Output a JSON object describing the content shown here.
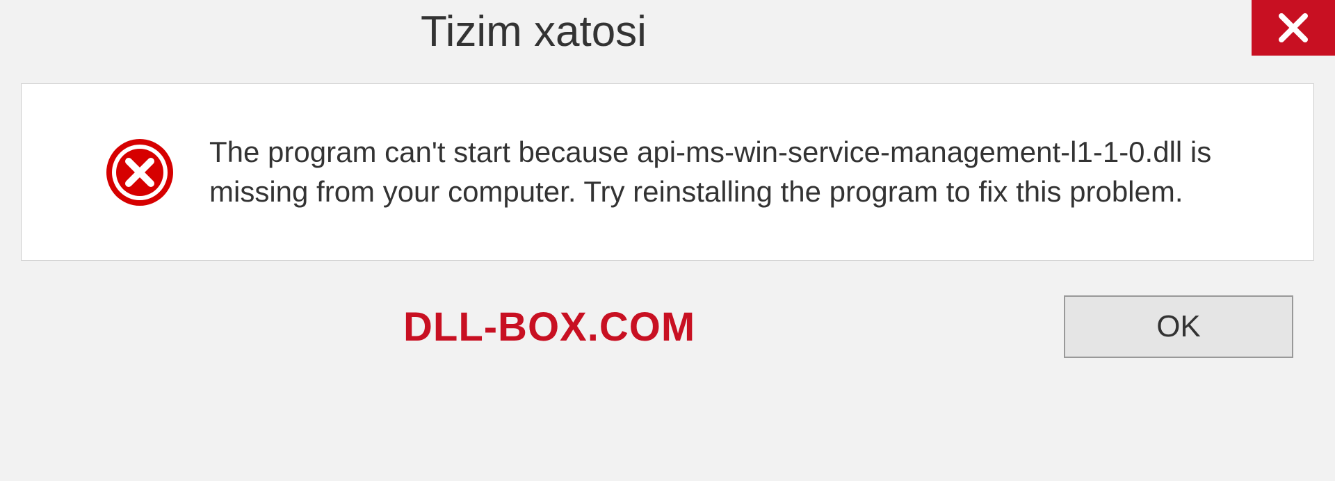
{
  "dialog": {
    "title": "Tizim xatosi",
    "message": "The program can't start because api-ms-win-service-management-l1-1-0.dll is missing from your computer. Try reinstalling the program to fix this problem.",
    "ok_label": "OK"
  },
  "watermark": "DLL-BOX.COM",
  "colors": {
    "accent_red": "#c81022"
  }
}
